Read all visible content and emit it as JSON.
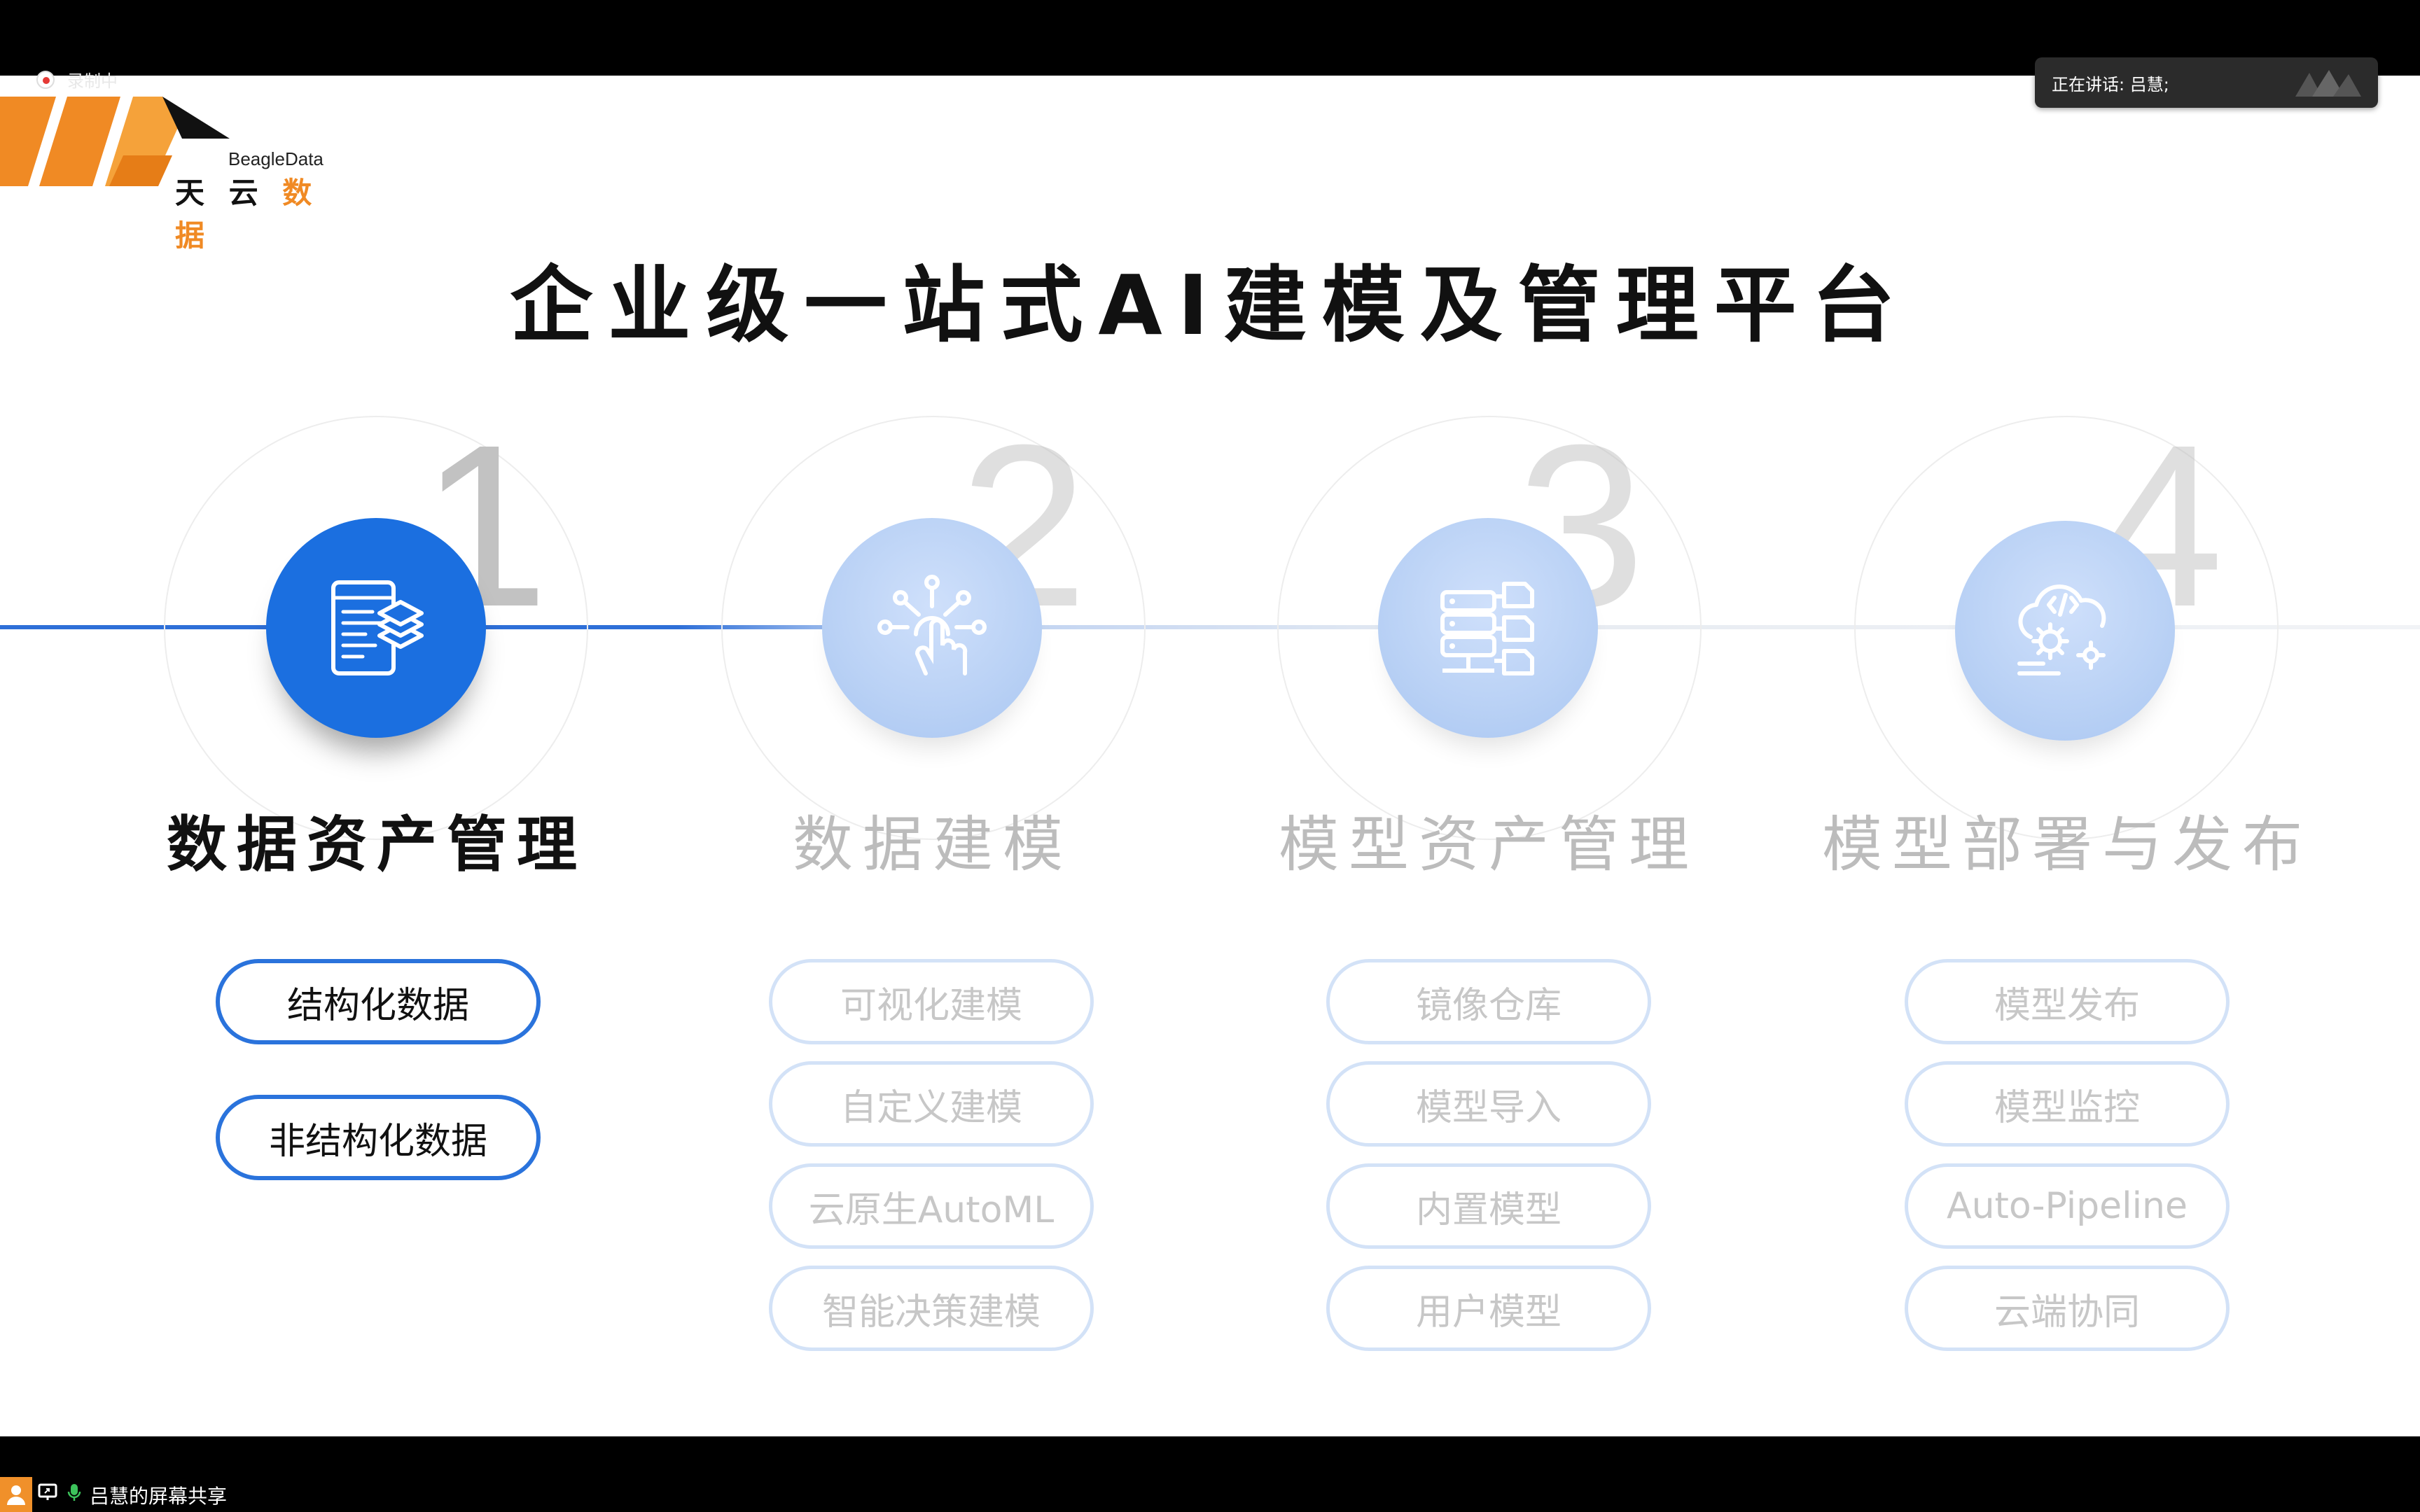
{
  "recording": {
    "label": "录制中"
  },
  "speaker": {
    "label": "正在讲话: 吕慧;"
  },
  "logo": {
    "en": "BeagleData",
    "cn_prefix": "天 云 ",
    "cn_highlight": "数 据"
  },
  "title": "企业级一站式AI建模及管理平台",
  "colors": {
    "accent": "#1b6fe0",
    "logo_orange": "#f08a24",
    "faded": "#bcbcbc"
  },
  "steps": [
    {
      "number": "1",
      "heading": "数据资产管理",
      "icon": "data-document-layers-icon",
      "active": true,
      "items": [
        "结构化数据",
        "非结构化数据"
      ]
    },
    {
      "number": "2",
      "heading": "数据建模",
      "icon": "touch-network-icon",
      "active": false,
      "items": [
        "可视化建模",
        "自定义建模",
        "云原生AutoML",
        "智能决策建模"
      ]
    },
    {
      "number": "3",
      "heading": "模型资产管理",
      "icon": "server-storage-icon",
      "active": false,
      "items": [
        "镜像仓库",
        "模型导入",
        "内置模型",
        "用户模型"
      ]
    },
    {
      "number": "4",
      "heading": "模型部署与发布",
      "icon": "cloud-gear-icon",
      "active": false,
      "items": [
        "模型发布",
        "模型监控",
        "Auto-Pipeline",
        "云端协同"
      ]
    }
  ],
  "share": {
    "label": "吕慧的屏幕共享"
  }
}
